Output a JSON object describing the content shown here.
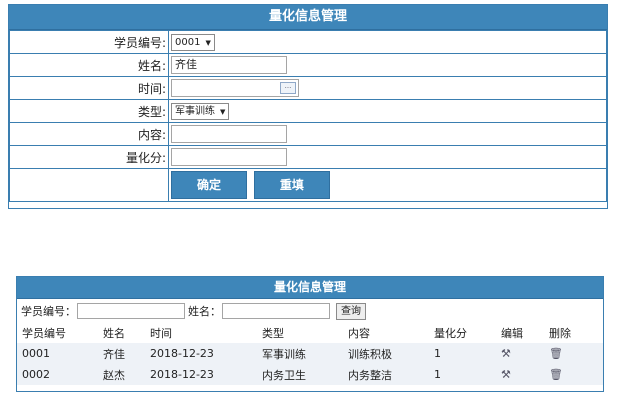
{
  "form": {
    "title": "量化信息管理",
    "fields": {
      "student_id": {
        "label": "学员编号:",
        "value": "0001"
      },
      "name": {
        "label": "姓名:",
        "value": "齐佳"
      },
      "time": {
        "label": "时间:",
        "value": ""
      },
      "type": {
        "label": "类型:",
        "value": "军事训练"
      },
      "content": {
        "label": "内容:",
        "value": ""
      },
      "score": {
        "label": "量化分:",
        "value": ""
      }
    },
    "confirm_label": "确定",
    "reset_label": "重填"
  },
  "list": {
    "title": "量化信息管理",
    "search": {
      "student_id_label": "学员编号：",
      "name_label": "姓名：",
      "query_label": "查询"
    },
    "columns": [
      "学员编号",
      "姓名",
      "时间",
      "类型",
      "内容",
      "量化分",
      "编辑",
      "删除"
    ],
    "rows": [
      [
        "0001",
        "齐佳",
        "2018-12-23",
        "军事训练",
        "训练积极",
        "1"
      ],
      [
        "0002",
        "赵杰",
        "2018-12-23",
        "内务卫生",
        "内务整洁",
        "1"
      ]
    ],
    "icons": {
      "edit": "edit-icon",
      "delete": "trash-icon"
    }
  },
  "colors": {
    "accent": "#3e86b9",
    "border": "#3a7eb0",
    "row_bg": "#eef2f7"
  }
}
